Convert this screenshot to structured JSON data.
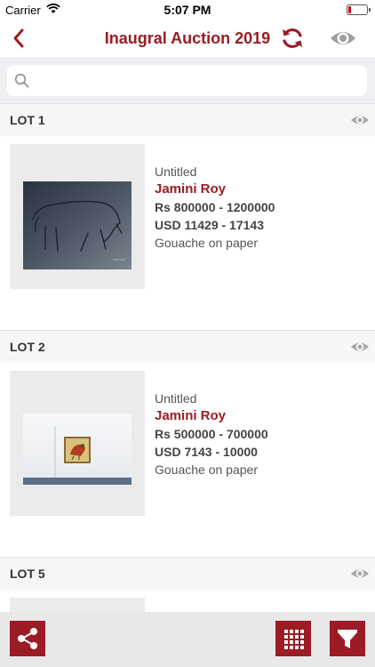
{
  "status": {
    "carrier": "Carrier",
    "time": "5:07 PM"
  },
  "nav": {
    "title": "Inaugral Auction 2019"
  },
  "search": {
    "placeholder": ""
  },
  "lots": [
    {
      "label": "LOT 1",
      "title": "Untitled",
      "artist": "Jamini Roy",
      "price_inr": "Rs 800000 - 1200000",
      "price_usd": "USD 11429 - 17143",
      "medium": "Gouache on paper"
    },
    {
      "label": "LOT 2",
      "title": "Untitled",
      "artist": "Jamini Roy",
      "price_inr": "Rs 500000 - 700000",
      "price_usd": "USD 7143 - 10000",
      "medium": "Gouache on paper"
    },
    {
      "label": "LOT 5"
    }
  ],
  "colors": {
    "accent": "#9b1c24",
    "toolbar_bg": "#e8e8e8",
    "header_bg": "#f6f6f6"
  },
  "icons": {
    "back": "chevron-left-icon",
    "refresh": "refresh-icon",
    "eye": "eye-icon",
    "search": "search-icon",
    "share": "share-icon",
    "grid": "grid-icon",
    "filter": "filter-icon"
  }
}
